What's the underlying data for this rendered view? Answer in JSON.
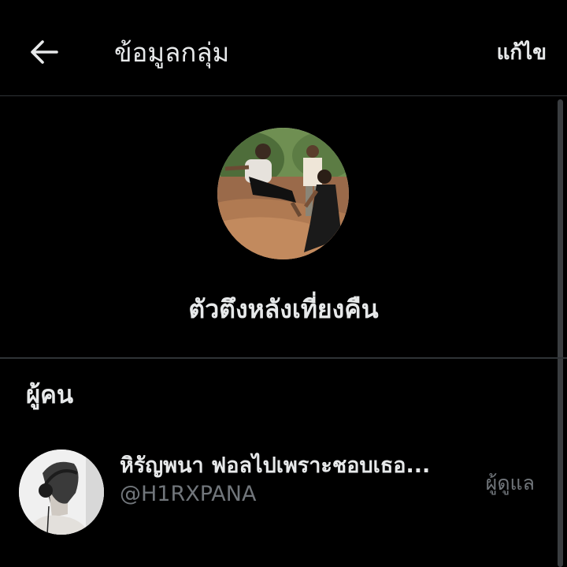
{
  "header": {
    "title": "ข้อมูลกลุ่ม",
    "edit_label": "แก้ไข",
    "back_icon": "arrow-left-icon"
  },
  "group": {
    "name": "ตัวตึงหลังเที่ยงคืน"
  },
  "people": {
    "section_title": "ผู้คน",
    "members": [
      {
        "display_name": "หิรัญพนา ฟอลไปเพราะชอบเธอ...",
        "handle": "@H1RXPANA",
        "role": "ผู้ดูแล"
      }
    ]
  },
  "colors": {
    "background": "#000000",
    "text_primary": "#e7e9ea",
    "text_secondary": "#71767b",
    "divider": "#2f3336"
  }
}
